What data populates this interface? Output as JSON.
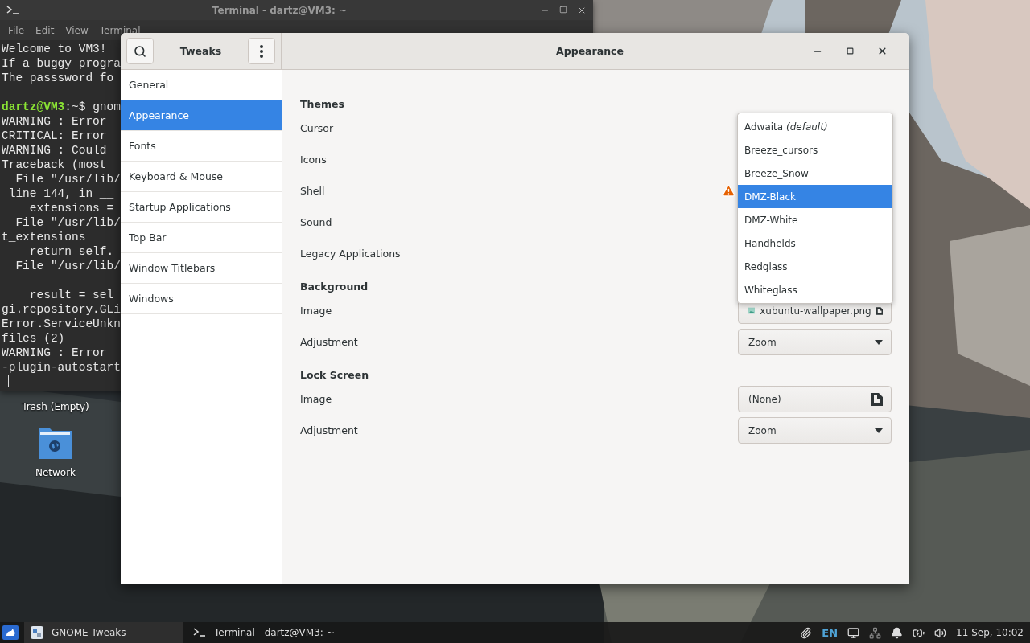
{
  "terminal": {
    "title": "Terminal - dartz@VM3: ~",
    "menu": [
      "File",
      "Edit",
      "View",
      "Terminal"
    ],
    "lines": [
      {
        "text": "Welcome to VM3!"
      },
      {
        "text": "If a buggy progra"
      },
      {
        "text": "The passsword fo"
      },
      {
        "prompt": "dartz@VM3",
        "text": ":~$ gnom",
        "blank_before": true
      },
      {
        "text": "WARNING : Error"
      },
      {
        "text": "CRITICAL: Error"
      },
      {
        "text": "WARNING : Could"
      },
      {
        "text": "Traceback (most"
      },
      {
        "text": "  File \"/usr/lib/"
      },
      {
        "text": " line 144, in __"
      },
      {
        "text": "    extensions ="
      },
      {
        "text": "  File \"/usr/lib/"
      },
      {
        "text": "t_extensions"
      },
      {
        "text": "    return self."
      },
      {
        "text": "  File \"/usr/lib/"
      },
      {
        "text": "__"
      },
      {
        "text": "    result = sel"
      },
      {
        "text": "gi.repository.GLi"
      },
      {
        "text": "Error.ServiceUnkn"
      },
      {
        "text": "files (2)"
      },
      {
        "text": "WARNING : Error"
      },
      {
        "text": "-plugin-autostart"
      }
    ]
  },
  "desktop_icons": [
    {
      "label": "Trash (Empty)",
      "kind": "trash"
    },
    {
      "label": "Network",
      "kind": "network"
    }
  ],
  "tweaks": {
    "title": "Tweaks",
    "page_title": "Appearance",
    "sidebar": [
      {
        "label": "General",
        "selected": false
      },
      {
        "label": "Appearance",
        "selected": true
      },
      {
        "label": "Fonts",
        "selected": false
      },
      {
        "label": "Keyboard & Mouse",
        "selected": false
      },
      {
        "label": "Startup Applications",
        "selected": false
      },
      {
        "label": "Top Bar",
        "selected": false
      },
      {
        "label": "Window Titlebars",
        "selected": false
      },
      {
        "label": "Windows",
        "selected": false
      }
    ],
    "sections": [
      {
        "title": "Themes",
        "rows": [
          {
            "label": "Cursor",
            "kind": "covered"
          },
          {
            "label": "Icons",
            "kind": "covered"
          },
          {
            "label": "Shell",
            "kind": "warning"
          },
          {
            "label": "Sound",
            "kind": "covered"
          },
          {
            "label": "Legacy Applications",
            "kind": "covered"
          }
        ]
      },
      {
        "title": "Background",
        "rows": [
          {
            "label": "Image",
            "kind": "file",
            "value": "xubuntu-wallpaper.png",
            "image": true
          },
          {
            "label": "Adjustment",
            "kind": "dropdown",
            "value": "Zoom"
          }
        ]
      },
      {
        "title": "Lock Screen",
        "rows": [
          {
            "label": "Image",
            "kind": "file",
            "value": "(None)",
            "image": false
          },
          {
            "label": "Adjustment",
            "kind": "dropdown",
            "value": "Zoom"
          }
        ]
      }
    ],
    "popup": {
      "items": [
        {
          "label": "Adwaita *(default)*",
          "selected": false
        },
        {
          "label": "Breeze_cursors",
          "selected": false
        },
        {
          "label": "Breeze_Snow",
          "selected": false
        },
        {
          "label": "DMZ-Black",
          "selected": true
        },
        {
          "label": "DMZ-White",
          "selected": false
        },
        {
          "label": "Handhelds",
          "selected": false
        },
        {
          "label": "Redglass",
          "selected": false
        },
        {
          "label": "Whiteglass",
          "selected": false
        }
      ]
    }
  },
  "taskbar": {
    "tasks": [
      {
        "label": "GNOME Tweaks",
        "kind": "tweaks",
        "selected": true
      },
      {
        "label": "Terminal - dartz@VM3: ~",
        "kind": "terminal",
        "selected": false
      }
    ],
    "language": "EN",
    "clock": "11 Sep, 10:02"
  }
}
